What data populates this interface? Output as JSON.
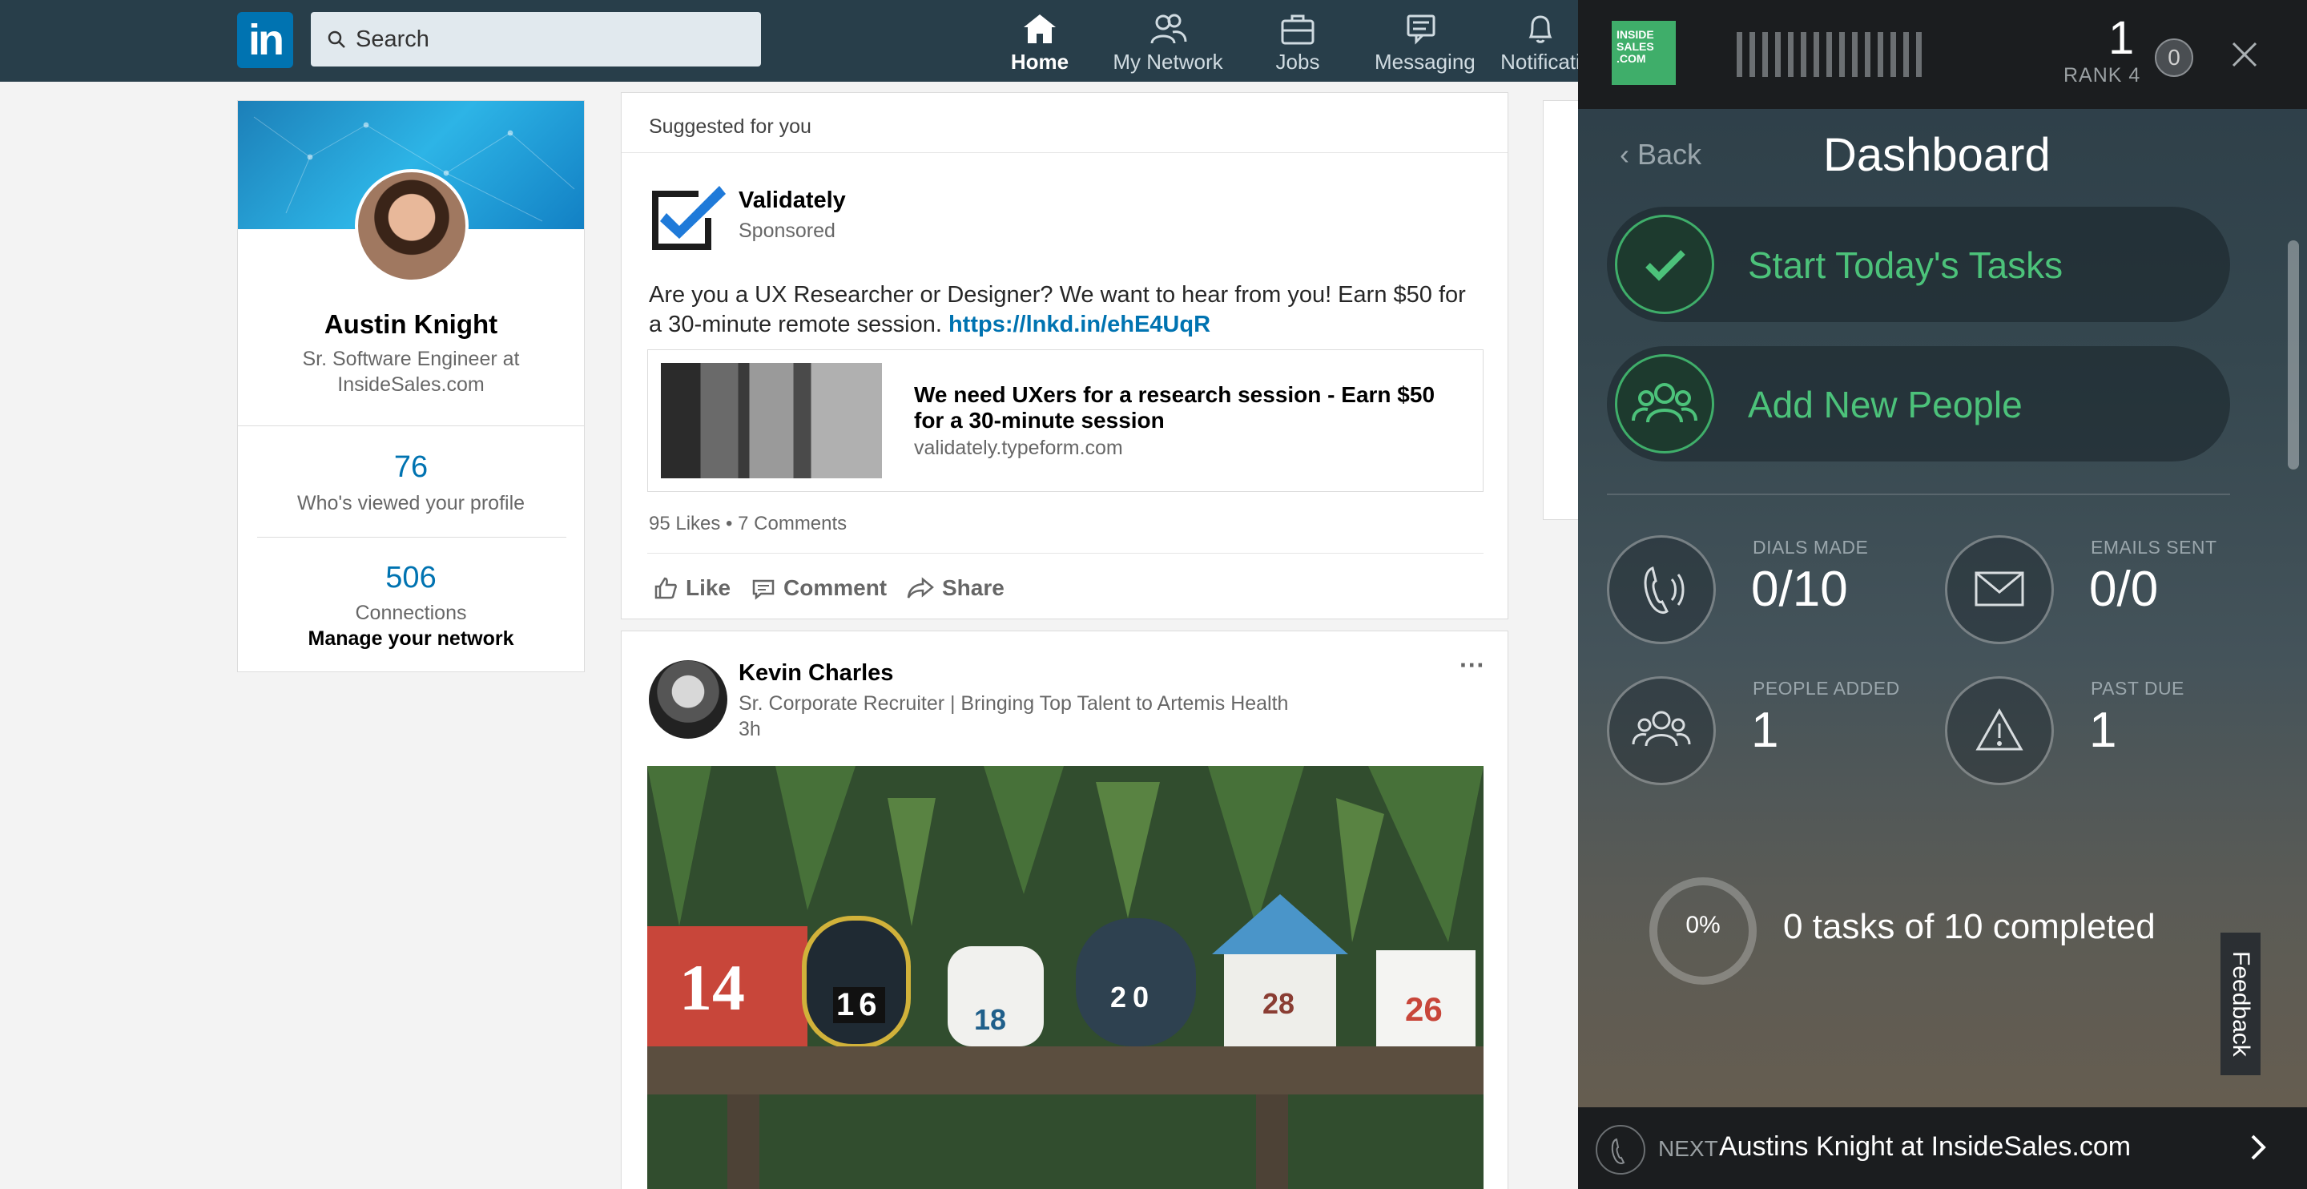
{
  "nav": {
    "logo": "in",
    "search_placeholder": "Search",
    "items": [
      {
        "label": "Home"
      },
      {
        "label": "My Network"
      },
      {
        "label": "Jobs"
      },
      {
        "label": "Messaging"
      },
      {
        "label": "Notificati"
      }
    ]
  },
  "profile": {
    "name": "Austin Knight",
    "title": "Sr. Software Engineer at InsideSales.com",
    "views_count": "76",
    "views_label": "Who's viewed your profile",
    "connections_count": "506",
    "connections_label": "Connections",
    "manage_label": "Manage your network"
  },
  "sponsored_post": {
    "header": "Suggested for you",
    "company": "Validately",
    "sponsored_label": "Sponsored",
    "text": "Are you a UX Researcher or Designer? We want to hear from you! Earn $50 for a 30-minute remote session.",
    "link_text": "https://lnkd.in/ehE4UqR",
    "link_title": "We need UXers for a research session - Earn $50 for a 30-minute session",
    "link_url": "validately.typeform.com",
    "social_counts": "95 Likes  •  7 Comments",
    "actions": {
      "like": "Like",
      "comment": "Comment",
      "share": "Share"
    }
  },
  "post": {
    "author": "Kevin Charles",
    "subtitle": "Sr. Corporate Recruiter | Bringing Top Talent to Artemis Health",
    "time": "3h",
    "more": "···",
    "mailbox_numbers": [
      "14",
      "16",
      "18",
      "20",
      "28",
      "26"
    ]
  },
  "panel": {
    "logo_text": "INSIDE SALES .COM",
    "rank_number": "1",
    "rank_label": "RANK 4",
    "badge_count": "0",
    "back_label": "Back",
    "title": "Dashboard",
    "actions": [
      {
        "label": "Start Today's Tasks"
      },
      {
        "label": "Add New People"
      }
    ],
    "stats": {
      "dials_label": "DIALS MADE",
      "dials_value": "0/10",
      "emails_label": "EMAILS SENT",
      "emails_value": "0/0",
      "people_label": "PEOPLE ADDED",
      "people_value": "1",
      "pastdue_label": "PAST DUE",
      "pastdue_value": "1"
    },
    "progress_percent": "0%",
    "progress_fraction": 0,
    "tasks_text": "0 tasks of 10 completed",
    "feedback_label": "Feedback",
    "next_label": "NEXT",
    "next_name": "Austins Knight at InsideSales.com"
  },
  "colors": {
    "linkedin_blue": "#0073b1",
    "nav_bg": "#283e4a",
    "panel_green": "#4cc27a"
  }
}
